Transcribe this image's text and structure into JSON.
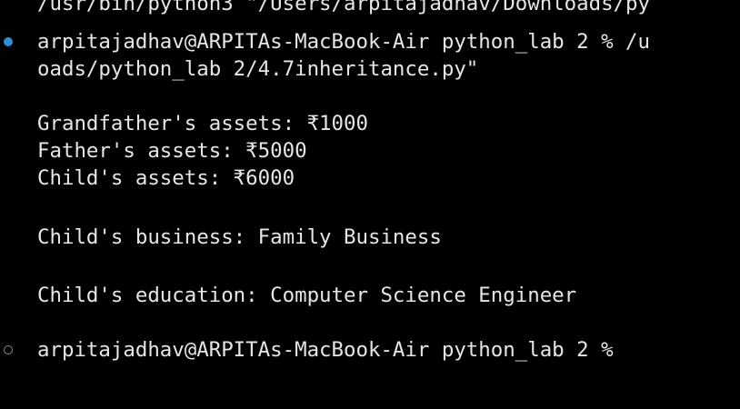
{
  "terminal": {
    "lines": [
      "/usr/bin/python3 \"/Users/arpitajadhav/Downloads/py",
      "arpitajadhav@ARPITAs-MacBook-Air python_lab 2 % /u",
      "oads/python_lab 2/4.7inheritance.py\"",
      "Grandfather's assets: ₹1000",
      "Father's assets: ₹5000",
      "Child's assets: ₹6000",
      "Child's business: Family Business",
      "Child's education: Computer Science Engineer",
      "arpitajadhav@ARPITAs-MacBook-Air python_lab 2 %"
    ],
    "markers": {
      "previous_command": "filled-circle-icon",
      "current_prompt": "hollow-circle-icon"
    }
  },
  "colors": {
    "background": "#000000",
    "text": "#e6e6e6",
    "success_marker": "#2d8fd5",
    "idle_marker": "#8a8a8a"
  }
}
